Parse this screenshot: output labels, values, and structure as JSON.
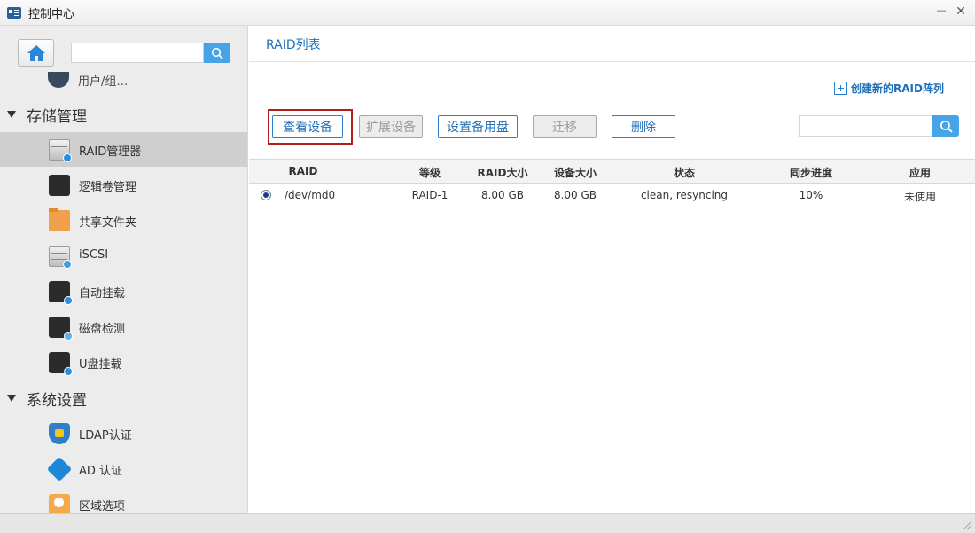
{
  "window": {
    "title": "控制中心",
    "min_icon": "minimize-icon",
    "close_icon": "close-icon"
  },
  "sidebar": {
    "search_placeholder": "",
    "partial_item_label": "用户/组…",
    "groups": [
      {
        "label": "存储管理"
      },
      {
        "label": "系统设置"
      }
    ],
    "storage_items": [
      {
        "label": "RAID管理器",
        "icon": "raid-server-icon",
        "active": true
      },
      {
        "label": "逻辑卷管理",
        "icon": "lvm-icon"
      },
      {
        "label": "共享文件夹",
        "icon": "shared-folder-icon"
      },
      {
        "label": "iSCSI",
        "icon": "iscsi-icon"
      },
      {
        "label": "自动挂载",
        "icon": "auto-mount-icon"
      },
      {
        "label": "磁盘检测",
        "icon": "disk-check-icon"
      },
      {
        "label": "U盘挂载",
        "icon": "usb-mount-icon"
      }
    ],
    "system_items": [
      {
        "label": "LDAP认证",
        "icon": "ldap-shield-icon"
      },
      {
        "label": "AD 认证",
        "icon": "ad-icon"
      },
      {
        "label": "区域选项",
        "icon": "region-icon"
      }
    ]
  },
  "main": {
    "title": "RAID列表",
    "create_link": "创建新的RAID阵列",
    "toolbar": {
      "view_device": "查看设备",
      "expand_device": "扩展设备",
      "set_spare": "设置备用盘",
      "migrate": "迁移",
      "delete": "删除"
    },
    "search_placeholder": "",
    "table": {
      "headers": [
        "RAID",
        "等级",
        "RAID大小",
        "设备大小",
        "状态",
        "同步进度",
        "应用"
      ],
      "rows": [
        {
          "selected": true,
          "raid": "/dev/md0",
          "level": "RAID-1",
          "raid_size": "8.00 GB",
          "device_size": "8.00 GB",
          "status": "clean, resyncing",
          "sync_progress": "10%",
          "usage": "未使用"
        }
      ]
    }
  },
  "colors": {
    "accent": "#1f6fb8",
    "search_button": "#45a3e6",
    "highlight_frame": "#b21e1e",
    "sidebar_bg": "#ececec",
    "active_item_bg": "#cfcfcf"
  }
}
